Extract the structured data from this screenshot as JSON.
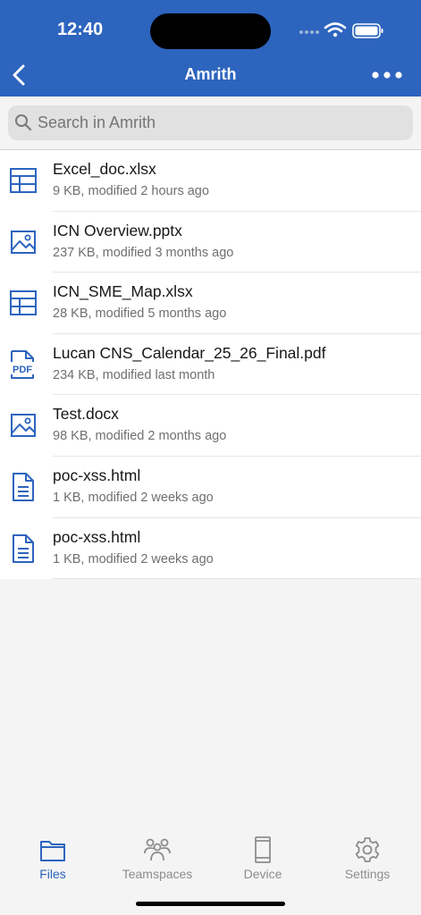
{
  "status_bar": {
    "time": "12:40"
  },
  "nav": {
    "title": "Amrith",
    "back_icon": "chevron-left-icon",
    "more_icon": "more-horizontal-icon"
  },
  "search": {
    "placeholder": "Search in Amrith"
  },
  "files": [
    {
      "name": "Excel_doc.xlsx",
      "meta": "9 KB, modified 2 hours ago",
      "icon": "spreadsheet-icon"
    },
    {
      "name": "ICN Overview.pptx",
      "meta": "237 KB, modified 3 months ago",
      "icon": "image-icon"
    },
    {
      "name": "ICN_SME_Map.xlsx",
      "meta": "28 KB, modified 5 months ago",
      "icon": "spreadsheet-icon"
    },
    {
      "name": "Lucan CNS_Calendar_25_26_Final.pdf",
      "meta": "234 KB, modified last month",
      "icon": "pdf-icon"
    },
    {
      "name": "Test.docx",
      "meta": "98 KB, modified 2 months ago",
      "icon": "image-icon"
    },
    {
      "name": "poc-xss.html",
      "meta": "1 KB, modified 2 weeks ago",
      "icon": "document-icon"
    },
    {
      "name": "poc-xss.html",
      "meta": "1 KB, modified 2 weeks ago",
      "icon": "document-icon"
    }
  ],
  "tabs": [
    {
      "label": "Files",
      "icon": "folder-icon",
      "active": true
    },
    {
      "label": "Teamspaces",
      "icon": "people-icon",
      "active": false
    },
    {
      "label": "Device",
      "icon": "device-icon",
      "active": false
    },
    {
      "label": "Settings",
      "icon": "gear-icon",
      "active": false
    }
  ],
  "colors": {
    "accent": "#2d64be",
    "icon_blue": "#2d64be",
    "inactive": "#8d8d8d"
  }
}
